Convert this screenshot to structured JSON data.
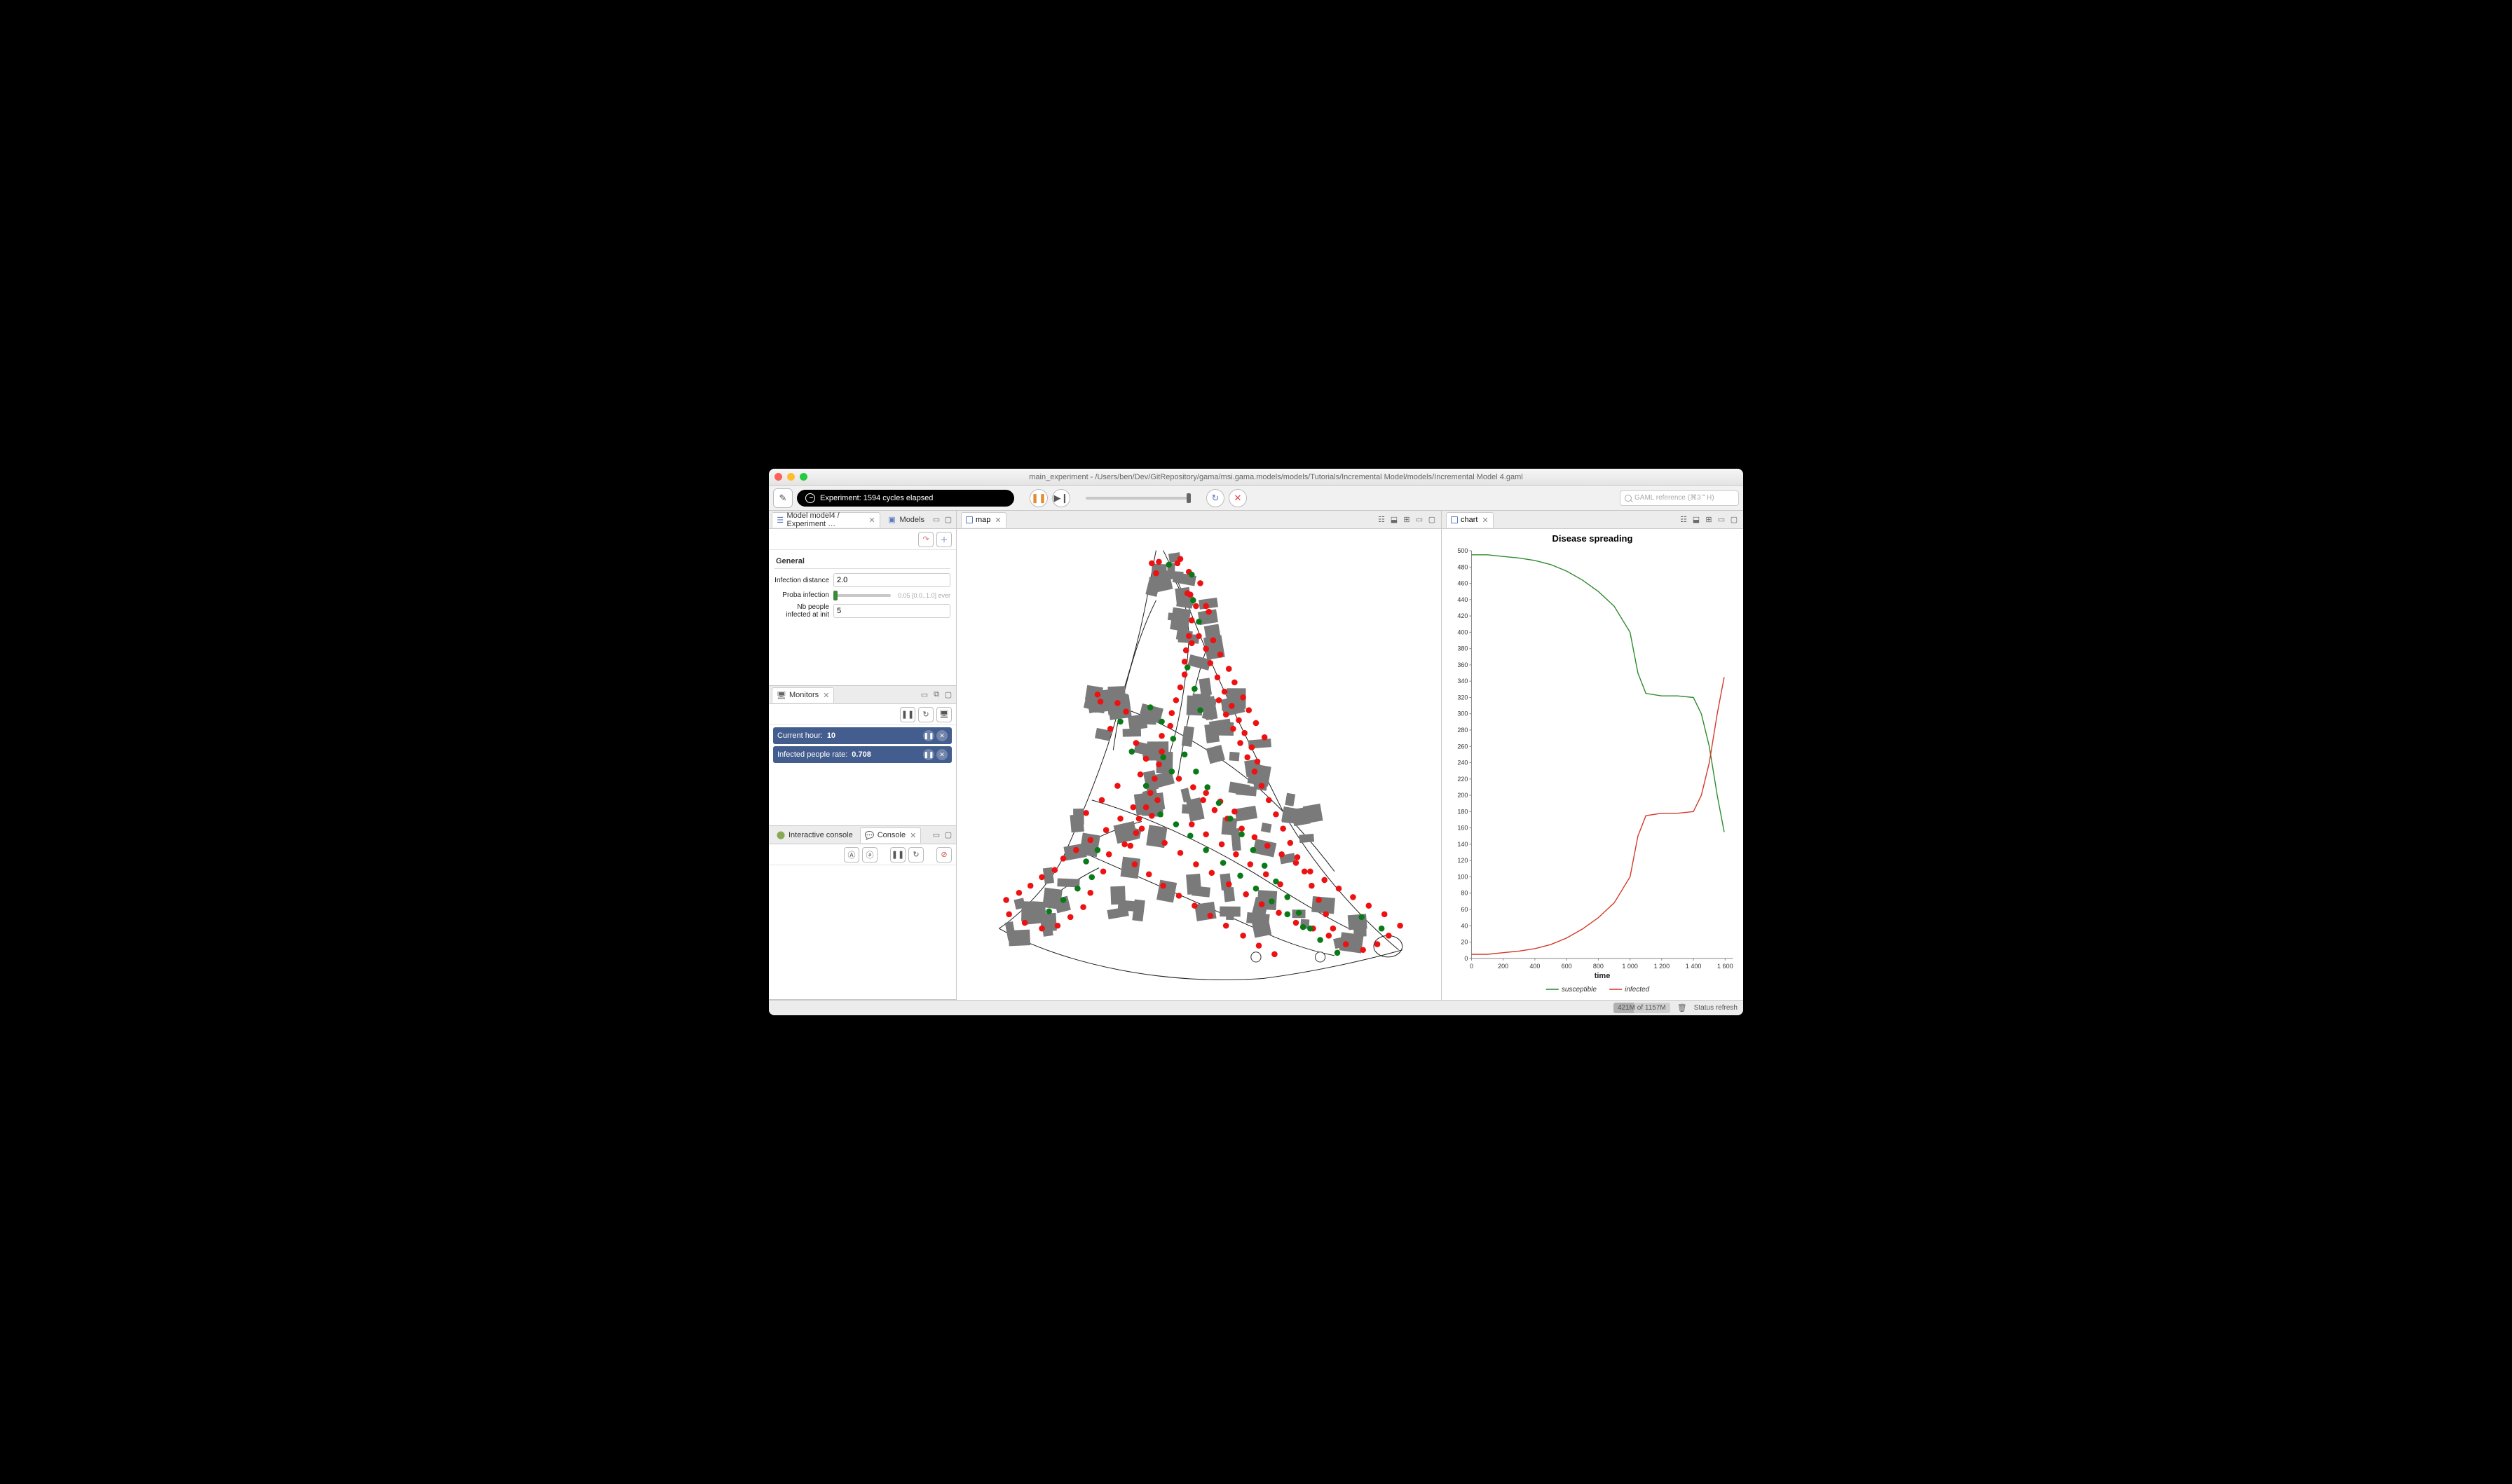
{
  "titlebar": {
    "title": "main_experiment - /Users/ben/Dev/GitRepository/gama/msi.gama.models/models/Tutorials/Incremental Model/models/Incremental Model 4.gaml"
  },
  "toolbar": {
    "experiment_status": "Experiment: 1594 cycles elapsed",
    "search_placeholder": "GAML reference (⌘3⌃H)"
  },
  "left": {
    "params_tab1": "Model model4 / Experiment …",
    "params_tab2": "Models",
    "section_general": "General",
    "param_infection_distance_label": "Infection distance",
    "param_infection_distance_value": "2.0",
    "param_proba_label": "Proba infection",
    "param_proba_hint": "0.05 [0.0..1.0] ever",
    "param_nb_label": "Nb people infected at init",
    "param_nb_value": "5",
    "monitors_tab": "Monitors",
    "monitor1_label": "Current hour:",
    "monitor1_value": "10",
    "monitor2_label": "Infected people rate:",
    "monitor2_value": "0.708",
    "console_tab1": "Interactive console",
    "console_tab2": "Console"
  },
  "map": {
    "tab_label": "map"
  },
  "chart": {
    "tab_label": "chart",
    "title": "Disease spreading",
    "xlabel": "time",
    "legend_susceptible": "susceptible",
    "legend_infected": "infected"
  },
  "statusbar": {
    "memory": "421M of 1157M",
    "status": "Status refresh"
  },
  "chart_data": {
    "type": "line",
    "title": "Disease spreading",
    "xlabel": "time",
    "ylabel": "",
    "xlim": [
      0,
      1650
    ],
    "ylim": [
      0,
      500
    ],
    "x_ticks": [
      0,
      200,
      400,
      600,
      800,
      1000,
      1200,
      1400,
      1600
    ],
    "y_ticks": [
      0,
      20,
      40,
      60,
      80,
      100,
      120,
      140,
      160,
      180,
      200,
      220,
      240,
      260,
      280,
      300,
      320,
      340,
      360,
      380,
      400,
      420,
      440,
      460,
      480,
      500
    ],
    "series": [
      {
        "name": "susceptible",
        "color": "#2e8b2e",
        "x": [
          0,
          100,
          200,
          300,
          400,
          500,
          600,
          700,
          800,
          900,
          1000,
          1050,
          1100,
          1200,
          1300,
          1400,
          1450,
          1500,
          1550,
          1594
        ],
        "y": [
          495,
          495,
          493,
          491,
          488,
          483,
          475,
          464,
          450,
          432,
          400,
          350,
          325,
          322,
          322,
          320,
          300,
          260,
          200,
          155
        ]
      },
      {
        "name": "infected",
        "color": "#d43a2a",
        "x": [
          0,
          100,
          200,
          300,
          400,
          500,
          600,
          700,
          800,
          900,
          1000,
          1050,
          1100,
          1200,
          1300,
          1400,
          1450,
          1500,
          1550,
          1594
        ],
        "y": [
          5,
          5,
          7,
          9,
          12,
          17,
          25,
          36,
          50,
          68,
          100,
          150,
          175,
          178,
          178,
          180,
          200,
          240,
          300,
          345
        ]
      }
    ]
  },
  "map_agents": {
    "red": [
      [
        254,
        46
      ],
      [
        244,
        48
      ],
      [
        250,
        62
      ],
      [
        280,
        48
      ],
      [
        284,
        42
      ],
      [
        296,
        60
      ],
      [
        294,
        90
      ],
      [
        298,
        92
      ],
      [
        312,
        76
      ],
      [
        306,
        108
      ],
      [
        300,
        128
      ],
      [
        296,
        150
      ],
      [
        292,
        170
      ],
      [
        290,
        186
      ],
      [
        290,
        204
      ],
      [
        284,
        222
      ],
      [
        278,
        240
      ],
      [
        272,
        258
      ],
      [
        270,
        276
      ],
      [
        258,
        290
      ],
      [
        258,
        312
      ],
      [
        254,
        330
      ],
      [
        248,
        350
      ],
      [
        242,
        370
      ],
      [
        236,
        390
      ],
      [
        226,
        406
      ],
      [
        222,
        426
      ],
      [
        214,
        444
      ],
      [
        300,
        160
      ],
      [
        320,
        108
      ],
      [
        324,
        116
      ],
      [
        310,
        150
      ],
      [
        320,
        168
      ],
      [
        326,
        188
      ],
      [
        336,
        208
      ],
      [
        346,
        228
      ],
      [
        356,
        248
      ],
      [
        366,
        268
      ],
      [
        374,
        286
      ],
      [
        384,
        306
      ],
      [
        392,
        326
      ],
      [
        330,
        156
      ],
      [
        340,
        176
      ],
      [
        352,
        196
      ],
      [
        360,
        215
      ],
      [
        372,
        236
      ],
      [
        380,
        254
      ],
      [
        390,
        272
      ],
      [
        402,
        292
      ],
      [
        168,
        232
      ],
      [
        172,
        242
      ],
      [
        196,
        244
      ],
      [
        208,
        256
      ],
      [
        186,
        280
      ],
      [
        222,
        300
      ],
      [
        236,
        322
      ],
      [
        228,
        344
      ],
      [
        252,
        380
      ],
      [
        244,
        402
      ],
      [
        230,
        420
      ],
      [
        206,
        442
      ],
      [
        184,
        456
      ],
      [
        176,
        480
      ],
      [
        158,
        510
      ],
      [
        148,
        530
      ],
      [
        130,
        544
      ],
      [
        112,
        556
      ],
      [
        90,
        560
      ],
      [
        66,
        552
      ],
      [
        44,
        540
      ],
      [
        40,
        520
      ],
      [
        58,
        510
      ],
      [
        74,
        500
      ],
      [
        90,
        488
      ],
      [
        108,
        478
      ],
      [
        120,
        462
      ],
      [
        138,
        450
      ],
      [
        158,
        436
      ],
      [
        180,
        422
      ],
      [
        200,
        406
      ],
      [
        218,
        390
      ],
      [
        262,
        440
      ],
      [
        284,
        454
      ],
      [
        306,
        470
      ],
      [
        328,
        482
      ],
      [
        352,
        498
      ],
      [
        376,
        512
      ],
      [
        398,
        526
      ],
      [
        422,
        538
      ],
      [
        446,
        552
      ],
      [
        470,
        560
      ],
      [
        492,
        570
      ],
      [
        516,
        582
      ],
      [
        540,
        590
      ],
      [
        560,
        582
      ],
      [
        576,
        570
      ],
      [
        592,
        556
      ],
      [
        570,
        540
      ],
      [
        548,
        528
      ],
      [
        526,
        516
      ],
      [
        506,
        504
      ],
      [
        486,
        492
      ],
      [
        466,
        480
      ],
      [
        446,
        468
      ],
      [
        426,
        456
      ],
      [
        406,
        444
      ],
      [
        388,
        432
      ],
      [
        370,
        420
      ],
      [
        350,
        406
      ],
      [
        332,
        394
      ],
      [
        316,
        380
      ],
      [
        300,
        414
      ],
      [
        320,
        428
      ],
      [
        342,
        442
      ],
      [
        362,
        456
      ],
      [
        382,
        470
      ],
      [
        404,
        484
      ],
      [
        424,
        498
      ],
      [
        220,
        470
      ],
      [
        240,
        484
      ],
      [
        260,
        500
      ],
      [
        282,
        514
      ],
      [
        304,
        528
      ],
      [
        326,
        542
      ],
      [
        348,
        556
      ],
      [
        372,
        570
      ],
      [
        394,
        584
      ],
      [
        416,
        596
      ],
      [
        320,
        370
      ],
      [
        340,
        382
      ],
      [
        360,
        396
      ],
      [
        196,
        360
      ],
      [
        174,
        380
      ],
      [
        152,
        398
      ],
      [
        282,
        350
      ],
      [
        302,
        362
      ],
      [
        338,
        240
      ],
      [
        348,
        260
      ],
      [
        358,
        280
      ],
      [
        368,
        300
      ],
      [
        378,
        320
      ],
      [
        388,
        340
      ],
      [
        398,
        360
      ],
      [
        408,
        380
      ],
      [
        418,
        400
      ],
      [
        428,
        420
      ],
      [
        438,
        440
      ],
      [
        448,
        460
      ],
      [
        458,
        480
      ],
      [
        468,
        500
      ],
      [
        478,
        520
      ],
      [
        488,
        540
      ],
      [
        498,
        560
      ]
    ],
    "green": [
      [
        268,
        50
      ],
      [
        300,
        64
      ],
      [
        302,
        100
      ],
      [
        310,
        130
      ],
      [
        294,
        194
      ],
      [
        304,
        224
      ],
      [
        312,
        254
      ],
      [
        200,
        270
      ],
      [
        216,
        312
      ],
      [
        236,
        360
      ],
      [
        256,
        400
      ],
      [
        278,
        414
      ],
      [
        298,
        430
      ],
      [
        320,
        450
      ],
      [
        344,
        468
      ],
      [
        368,
        486
      ],
      [
        390,
        504
      ],
      [
        412,
        522
      ],
      [
        434,
        540
      ],
      [
        456,
        558
      ],
      [
        480,
        576
      ],
      [
        504,
        594
      ],
      [
        260,
        320
      ],
      [
        272,
        340
      ],
      [
        152,
        466
      ],
      [
        168,
        450
      ],
      [
        242,
        250
      ],
      [
        258,
        270
      ],
      [
        274,
        294
      ],
      [
        290,
        316
      ],
      [
        306,
        340
      ],
      [
        322,
        362
      ],
      [
        338,
        384
      ],
      [
        354,
        406
      ],
      [
        370,
        428
      ],
      [
        386,
        450
      ],
      [
        402,
        472
      ],
      [
        418,
        494
      ],
      [
        434,
        516
      ],
      [
        450,
        538
      ],
      [
        466,
        560
      ],
      [
        100,
        536
      ],
      [
        120,
        520
      ],
      [
        140,
        504
      ],
      [
        160,
        488
      ],
      [
        566,
        560
      ],
      [
        538,
        544
      ]
    ]
  }
}
